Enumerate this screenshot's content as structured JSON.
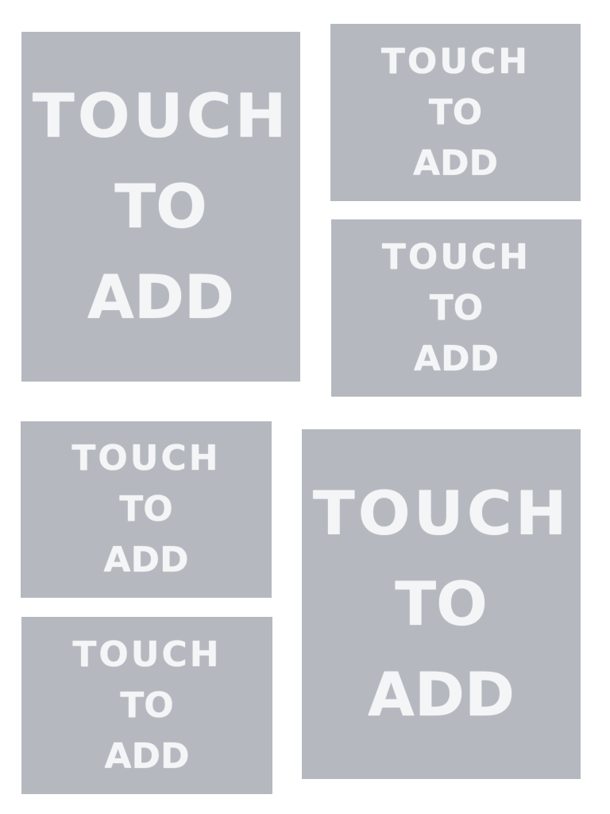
{
  "slots": [
    {
      "lines": [
        "TOUCH",
        "TO",
        "ADD"
      ]
    },
    {
      "lines": [
        "TOUCH",
        "TO",
        "ADD"
      ]
    },
    {
      "lines": [
        "TOUCH",
        "TO",
        "ADD"
      ]
    },
    {
      "lines": [
        "TOUCH",
        "TO",
        "ADD"
      ]
    },
    {
      "lines": [
        "TOUCH",
        "TO",
        "ADD"
      ]
    },
    {
      "lines": [
        "TOUCH",
        "TO",
        "ADD"
      ]
    }
  ],
  "colors": {
    "background": "#ffffff",
    "slot_fill": "#b5b9bf",
    "slot_text": "#f4f5f7"
  }
}
